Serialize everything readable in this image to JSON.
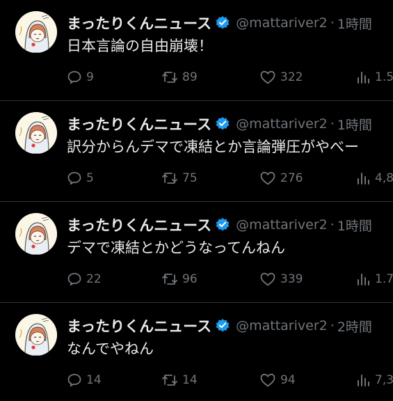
{
  "colors": {
    "background": "#000000",
    "text_primary": "#e7e9ea",
    "text_secondary": "#71767b",
    "verified_badge": "#1d9bf0",
    "divider": "#2f3336"
  },
  "icons": {
    "reply": "reply-icon",
    "retweet": "retweet-icon",
    "like": "heart-icon",
    "views": "views-icon",
    "verified": "verified-badge-icon"
  },
  "tweets": [
    {
      "display_name": "まったりくんニュース",
      "handle": "@mattariver2",
      "separator": "·",
      "time": "1時間",
      "text": "日本言論の自由崩壊！",
      "replies": "9",
      "retweets": "89",
      "likes": "322",
      "views": "1.5"
    },
    {
      "display_name": "まったりくんニュース",
      "handle": "@mattariver2",
      "separator": "·",
      "time": "1時間",
      "text": "訳分からんデマで凍結とか言論弾圧がやべー",
      "replies": "5",
      "retweets": "75",
      "likes": "276",
      "views": "4,8"
    },
    {
      "display_name": "まったりくんニュース",
      "handle": "@mattariver2",
      "separator": "·",
      "time": "1時間",
      "text": "デマで凍結とかどうなってんねん",
      "replies": "22",
      "retweets": "96",
      "likes": "339",
      "views": "1.7"
    },
    {
      "display_name": "まったりくんニュース",
      "handle": "@mattariver2",
      "separator": "·",
      "time": "2時間",
      "text": "なんでやねん",
      "replies": "14",
      "retweets": "14",
      "likes": "94",
      "views": "7,3"
    }
  ]
}
